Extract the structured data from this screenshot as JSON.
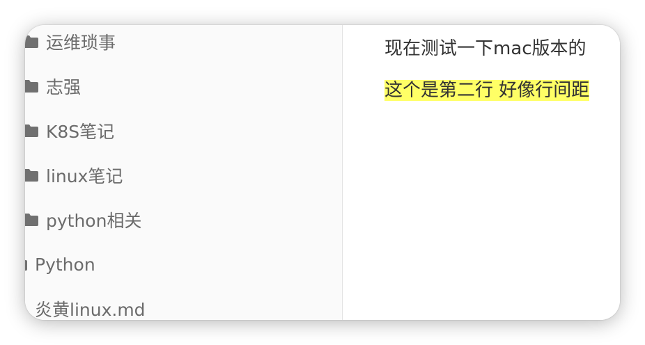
{
  "sidebar": {
    "items": [
      {
        "label": "运维琐事",
        "icon": "folder-icon"
      },
      {
        "label": "志强",
        "icon": "folder-icon"
      },
      {
        "label": "K8S笔记",
        "icon": "folder-icon"
      },
      {
        "label": "linux笔记",
        "icon": "folder-icon"
      },
      {
        "label": "python相关",
        "icon": "folder-icon"
      },
      {
        "label": "Python",
        "icon": "folder-icon"
      },
      {
        "label": "炎黄linux.md",
        "icon": "file-icon"
      }
    ]
  },
  "editor": {
    "lines": [
      {
        "text": "现在测试一下mac版本的"
      },
      {
        "text": "这个是第二行 好像行间距",
        "highlight_color": "#ffff66"
      }
    ]
  },
  "colors": {
    "sidebar_bg": "#fafafa",
    "icon": "#707070",
    "sidebar_text": "#6b6b6b",
    "editor_text": "#333333",
    "highlight": "#ffff66"
  }
}
